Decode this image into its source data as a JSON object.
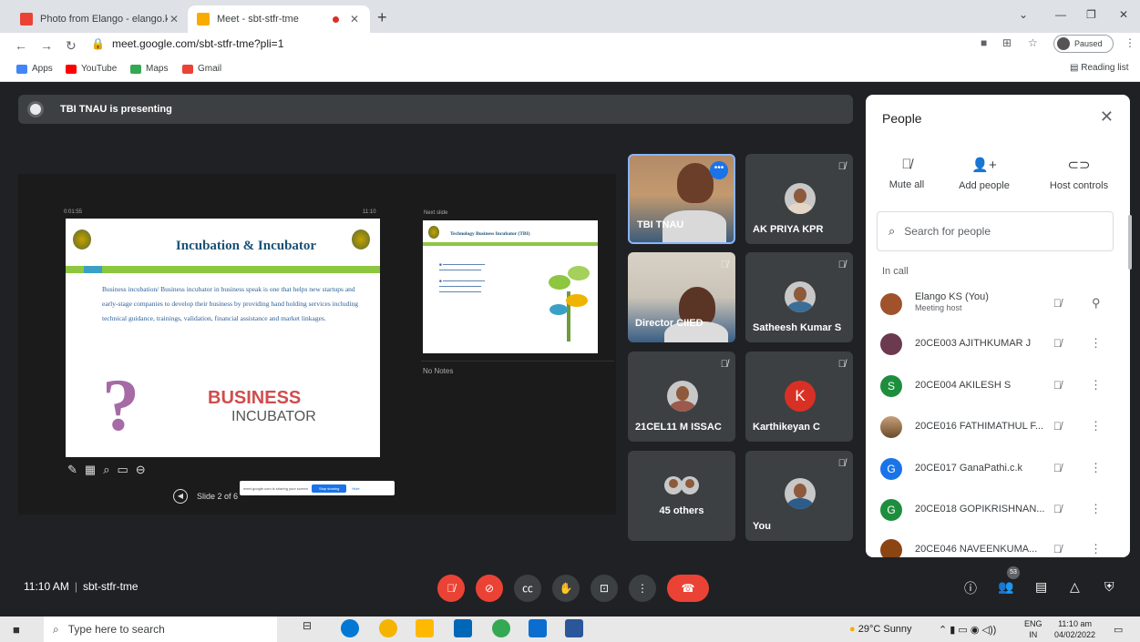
{
  "browser": {
    "tabs": [
      {
        "title": "Photo from Elango - elango.ks@...",
        "active": false,
        "favicon_color": "#ea4335"
      },
      {
        "title": "Meet - sbt-stfr-tme",
        "active": true,
        "favicon_color": "#f9ab00"
      }
    ],
    "url": "meet.google.com/sbt-stfr-tme?pli=1",
    "profile_status": "Paused",
    "bookmarks": [
      "Apps",
      "YouTube",
      "Maps",
      "Gmail"
    ],
    "reading_list": "Reading list"
  },
  "meet": {
    "presenting_banner": "TBI TNAU is presenting",
    "presentation": {
      "elapsed": "0:01:55",
      "clock": "11:10",
      "next_slide_label": "Next slide",
      "notes": "No Notes",
      "slide_counter": "Slide 2 of 6",
      "slide_title": "Incubation & Incubator",
      "slide_body": "Business incubation/ Business incubator in business speak is one that helps new startups and early-stage companies to develop their business by providing hand holding services including technical guidance, trainings, validation, financial assistance and market linkages.",
      "slide_art_word1": "BUSINESS",
      "slide_art_word2": "INCUBATOR",
      "next_title": "Technology Business Incubator (TBI)",
      "toast_text": "meet.google.com is sharing your screen",
      "toast_stop": "Stop sharing",
      "toast_hide": "Hide"
    },
    "tiles": [
      {
        "name": "TBI TNAU",
        "type": "video"
      },
      {
        "name": "AK PRIYA KPR",
        "type": "avatar"
      },
      {
        "name": "Director CIIED",
        "type": "video"
      },
      {
        "name": "Satheesh Kumar S",
        "type": "avatar"
      },
      {
        "name": "21CEL11 M ISSAC",
        "type": "avatar"
      },
      {
        "name": "Karthikeyan C",
        "type": "letter",
        "letter": "K"
      },
      {
        "name": "45 others",
        "type": "group"
      },
      {
        "name": "You",
        "type": "avatar"
      }
    ],
    "meeting_time": "11:10 AM",
    "meeting_code": "sbt-stfr-tme",
    "participant_count": "53"
  },
  "people_panel": {
    "title": "People",
    "actions": [
      "Mute all",
      "Add people",
      "Host controls"
    ],
    "search_placeholder": "Search for people",
    "section": "In call",
    "participants": [
      {
        "name": "Elango KS (You)",
        "sub": "Meeting host",
        "avatar": "photo"
      },
      {
        "name": "20CE003 AJITHKUMAR J",
        "avatar": "photo"
      },
      {
        "name": "20CE004 AKILESH S",
        "avatar": "S",
        "color": "#1e8e3e"
      },
      {
        "name": "20CE016 FATHIMATHUL F...",
        "avatar": "photo"
      },
      {
        "name": "20CE017 GanaPathi.c.k",
        "avatar": "G",
        "color": "#1a73e8"
      },
      {
        "name": "20CE018 GOPIKRISHNAN...",
        "avatar": "G",
        "color": "#1e8e3e"
      },
      {
        "name": "20CE046 NAVEENKUMA...",
        "avatar": "photo"
      }
    ]
  },
  "taskbar": {
    "search_placeholder": "Type here to search",
    "weather": "29°C Sunny",
    "lang1": "ENG",
    "lang2": "IN",
    "time": "11:10 am",
    "date": "04/02/2022"
  }
}
